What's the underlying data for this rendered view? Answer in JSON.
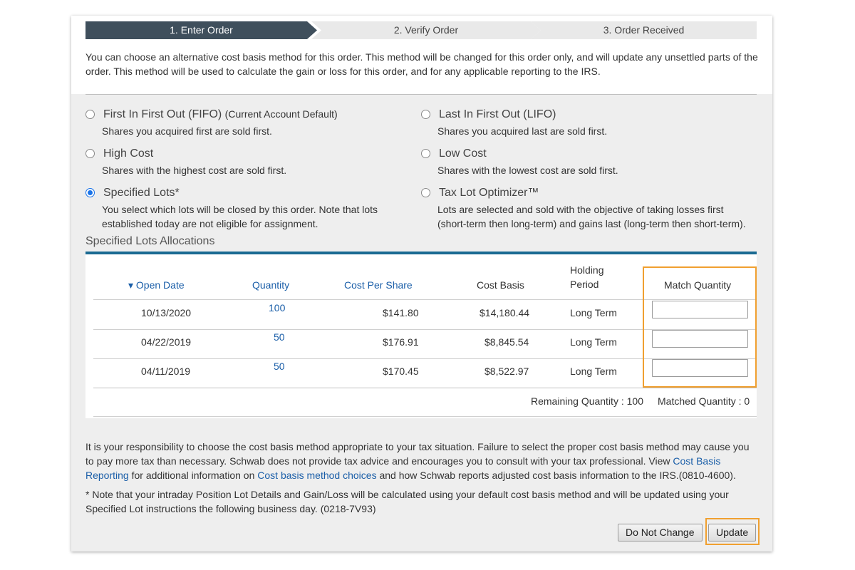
{
  "stepper": {
    "steps": [
      {
        "label": "1. Enter Order",
        "active": true
      },
      {
        "label": "2. Verify Order",
        "active": false
      },
      {
        "label": "3. Order Received",
        "active": false
      }
    ]
  },
  "intro_text": "You can choose an alternative cost basis method for this order. This method will be changed for this order only, and will update any unsettled parts of the order. This method will be used to calculate the gain or loss for this order, and for any applicable reporting to the IRS.",
  "methods": [
    {
      "title": "First In First Out (FIFO)",
      "tag": "(Current Account Default)",
      "desc": [
        "Shares you acquired first are sold first."
      ],
      "selected": false
    },
    {
      "title": "Last In First Out (LIFO)",
      "tag": "",
      "desc": [
        "Shares you acquired last are sold first."
      ],
      "selected": false
    },
    {
      "title": "High Cost",
      "tag": "",
      "desc": [
        "Shares with the highest cost are sold first."
      ],
      "selected": false
    },
    {
      "title": "Low Cost",
      "tag": "",
      "desc": [
        "Shares with the lowest cost are sold first."
      ],
      "selected": false
    },
    {
      "title": "Specified Lots*",
      "tag": "",
      "desc": [
        "You select which lots will be closed by this order. Note that lots",
        "established today are not eligible for assignment."
      ],
      "selected": true
    },
    {
      "title": "Tax Lot Optimizer™",
      "tag": "",
      "desc": [
        "Lots are selected and sold with the objective of taking losses first",
        "(short-term then long-term) and gains last (long-term then short-term)."
      ],
      "selected": false
    }
  ],
  "allocations": {
    "title": "Specified Lots Allocations",
    "headers": {
      "open_date": "▾ Open Date",
      "quantity": "Quantity",
      "cost_per_share": "Cost Per Share",
      "cost_basis": "Cost Basis",
      "holding_period_1": "Holding",
      "holding_period_2": "Period",
      "match_quantity": "Match Quantity"
    },
    "rows": [
      {
        "open_date": "10/13/2020",
        "quantity": "100",
        "cost_per_share": "$141.80",
        "cost_basis": "$14,180.44",
        "holding_period": "Long Term",
        "match_value": ""
      },
      {
        "open_date": "04/22/2019",
        "quantity": "50",
        "cost_per_share": "$176.91",
        "cost_basis": "$8,845.54",
        "holding_period": "Long Term",
        "match_value": ""
      },
      {
        "open_date": "04/11/2019",
        "quantity": "50",
        "cost_per_share": "$170.45",
        "cost_basis": "$8,522.97",
        "holding_period": "Long Term",
        "match_value": ""
      }
    ],
    "remaining_quantity": "Remaining Quantity : 100",
    "matched_quantity": "Matched Quantity : 0"
  },
  "footer": {
    "p1_a": "It is your responsibility to choose the cost basis method appropriate to your tax situation. Failure to select the proper cost basis method may cause you to pay more tax than necessary. Schwab does not provide tax advice and encourages you to consult with your tax professional. View ",
    "link1": "Cost Basis Reporting",
    "p1_b": " for additional information on ",
    "link2": "Cost basis method choices",
    "p1_c": " and how Schwab reports adjusted cost basis information to the IRS.(0810-4600).",
    "note": "* Note that your intraday Position Lot Details and Gain/Loss will be calculated using your default cost basis method and will be updated using your Specified Lot instructions the following business day. (0218-7V93)"
  },
  "buttons": {
    "do_not_change": "Do Not Change",
    "update": "Update"
  },
  "colors": {
    "active_step": "#3f4f5c",
    "link": "#1a5ea8",
    "highlight": "#f0a030",
    "accent_bar": "#1a6a92"
  }
}
